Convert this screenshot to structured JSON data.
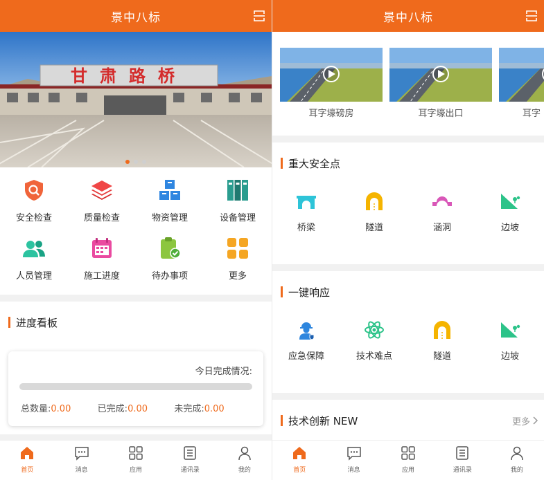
{
  "app": {
    "title": "景中八标"
  },
  "left": {
    "grid": [
      {
        "label": "安全检查",
        "icon": "shield-search-icon"
      },
      {
        "label": "质量检查",
        "icon": "layers-icon"
      },
      {
        "label": "物资管理",
        "icon": "boxes-icon"
      },
      {
        "label": "设备管理",
        "icon": "binders-icon"
      },
      {
        "label": "人员管理",
        "icon": "people-icon"
      },
      {
        "label": "施工进度",
        "icon": "calendar-icon"
      },
      {
        "label": "待办事项",
        "icon": "clipboard-check-icon"
      },
      {
        "label": "更多",
        "icon": "more-grid-icon"
      }
    ],
    "board": {
      "heading": "进度看板",
      "today_label": "今日完成情况:",
      "progress": 0,
      "total_label": "总数量:",
      "total_value": "0.00",
      "done_label": "已完成:",
      "done_value": "0.00",
      "undone_label": "未完成:",
      "undone_value": "0.00"
    }
  },
  "right": {
    "videos": [
      {
        "label": "耳字壕磅房"
      },
      {
        "label": "耳字壕出口"
      },
      {
        "label": "耳字"
      }
    ],
    "safety": {
      "heading": "重大安全点",
      "items": [
        {
          "label": "桥梁",
          "icon": "bridge-icon"
        },
        {
          "label": "隧道",
          "icon": "tunnel-icon"
        },
        {
          "label": "涵洞",
          "icon": "culvert-icon"
        },
        {
          "label": "边坡",
          "icon": "slope-icon"
        }
      ]
    },
    "response": {
      "heading": "一键响应",
      "items": [
        {
          "label": "应急保障",
          "icon": "worker-icon"
        },
        {
          "label": "技术难点",
          "icon": "atom-icon"
        },
        {
          "label": "隧道",
          "icon": "tunnel-icon"
        },
        {
          "label": "边坡",
          "icon": "slope-icon"
        }
      ]
    },
    "innovation": {
      "heading": "技术创新 NEW",
      "more": "更多"
    }
  },
  "tabbar": [
    {
      "label": "首页",
      "icon": "home-icon"
    },
    {
      "label": "消息",
      "icon": "message-icon"
    },
    {
      "label": "应用",
      "icon": "apps-icon"
    },
    {
      "label": "通讯录",
      "icon": "contacts-icon"
    },
    {
      "label": "我的",
      "icon": "person-icon"
    }
  ],
  "banner_sign": "甘肃路桥",
  "colors": {
    "accent": "#ef6a1c",
    "green": "#2cc3a0",
    "red": "#e8483f",
    "blue": "#2e86de"
  }
}
